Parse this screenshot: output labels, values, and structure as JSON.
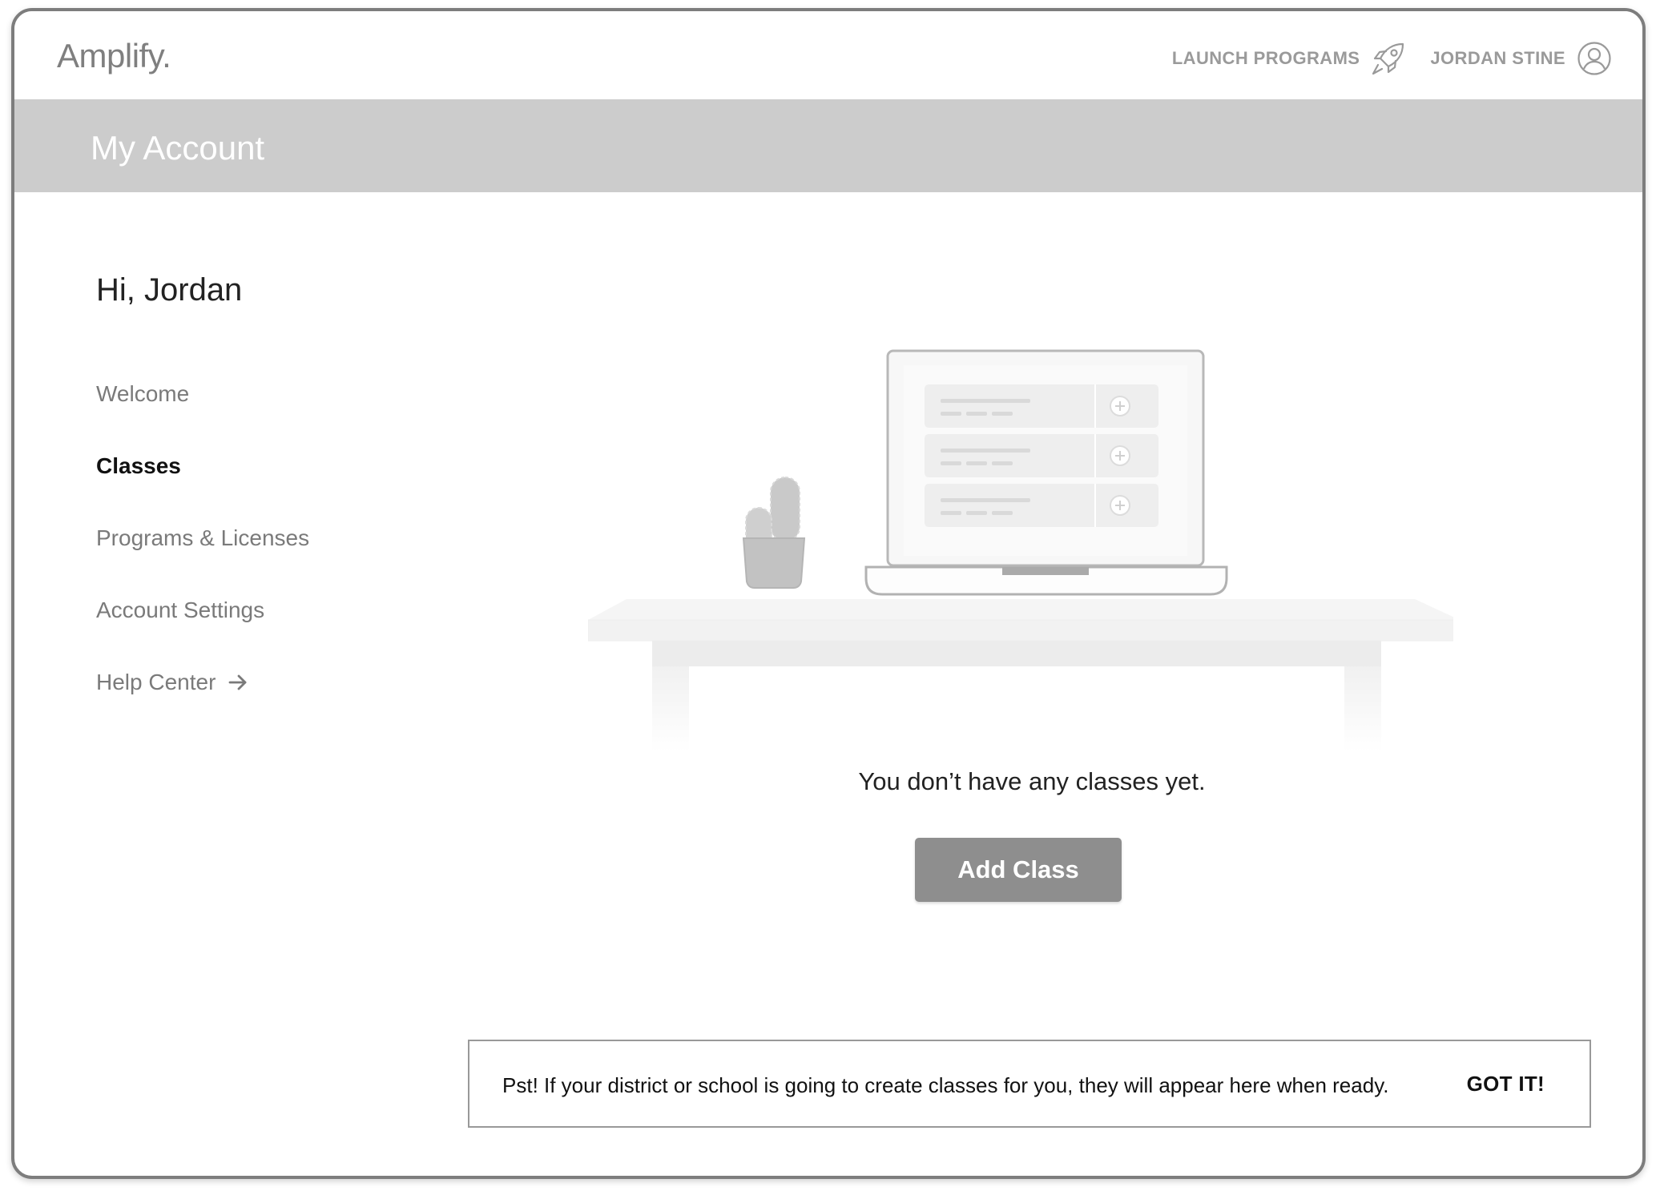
{
  "header": {
    "logo": "Amplify.",
    "launch_programs": "LAUNCH PROGRAMS",
    "user_name": "JORDAN STINE",
    "icons": {
      "launch": "rocket-icon",
      "user": "user-circle-icon"
    }
  },
  "banner": {
    "title": "My Account"
  },
  "sidebar": {
    "greeting": "Hi, Jordan",
    "items": [
      {
        "label": "Welcome",
        "active": false
      },
      {
        "label": "Classes",
        "active": true
      },
      {
        "label": "Programs & Licenses",
        "active": false
      },
      {
        "label": "Account Settings",
        "active": false
      },
      {
        "label": "Help Center",
        "active": false,
        "icon": "arrow-right-icon"
      }
    ]
  },
  "main": {
    "empty_state": "You don’t have any classes yet.",
    "add_class_label": "Add Class"
  },
  "tip": {
    "text": "Pst! If your district or school is going to create classes for you, they will appear here when ready.",
    "dismiss_label": "GOT IT!"
  },
  "colors": {
    "banner": "#cccccc",
    "button": "#8e8e8e",
    "frame": "#7d7d7d"
  }
}
